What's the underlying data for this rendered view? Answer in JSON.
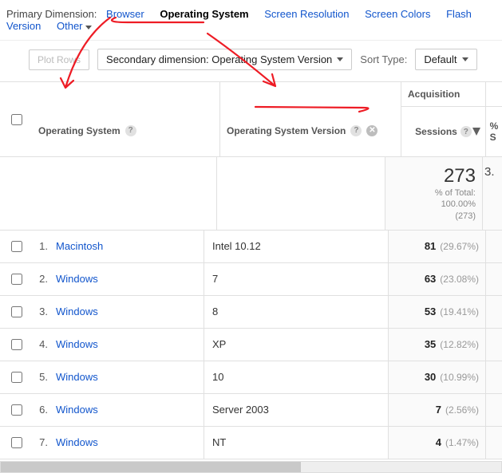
{
  "primary_dimension_label": "Primary Dimension:",
  "tabs": {
    "browser": "Browser",
    "os": "Operating System",
    "res": "Screen Resolution",
    "colors": "Screen Colors",
    "flash": "Flash Version",
    "other": "Other"
  },
  "controls": {
    "plot_rows": "Plot Rows",
    "secondary_dd": "Secondary dimension: Operating System Version",
    "sort_type": "Sort Type:",
    "default": "Default"
  },
  "headers": {
    "os": "Operating System",
    "osv": "Operating System Version",
    "acq": "Acquisition",
    "sessions": "Sessions",
    "perc_s": "%\nS"
  },
  "summary": {
    "total": "273",
    "pct_label": "% of Total:",
    "pct": "100.00%",
    "count": "(273)",
    "extra": "3."
  },
  "rows": [
    {
      "n": "1.",
      "os": "Macintosh",
      "ver": "Intel 10.12",
      "sess": "81",
      "pct": "(29.67%)"
    },
    {
      "n": "2.",
      "os": "Windows",
      "ver": "7",
      "sess": "63",
      "pct": "(23.08%)"
    },
    {
      "n": "3.",
      "os": "Windows",
      "ver": "8",
      "sess": "53",
      "pct": "(19.41%)"
    },
    {
      "n": "4.",
      "os": "Windows",
      "ver": "XP",
      "sess": "35",
      "pct": "(12.82%)"
    },
    {
      "n": "5.",
      "os": "Windows",
      "ver": "10",
      "sess": "30",
      "pct": "(10.99%)"
    },
    {
      "n": "6.",
      "os": "Windows",
      "ver": "Server 2003",
      "sess": "7",
      "pct": "(2.56%)"
    },
    {
      "n": "7.",
      "os": "Windows",
      "ver": "NT",
      "sess": "4",
      "pct": "(1.47%)"
    }
  ]
}
